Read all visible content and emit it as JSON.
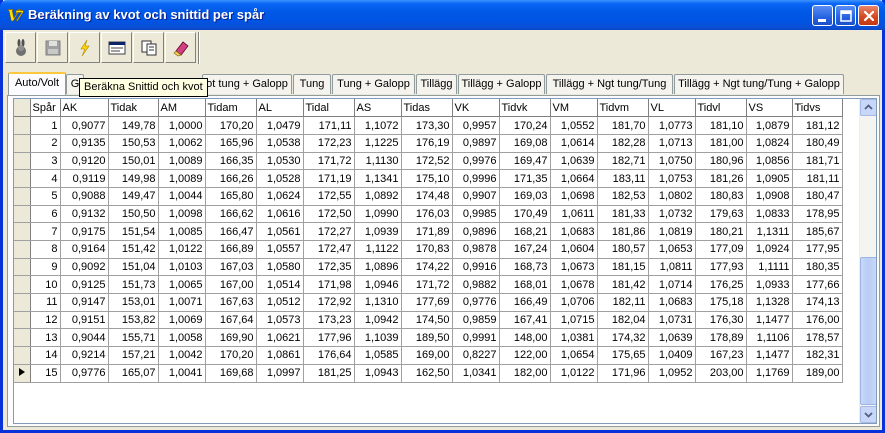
{
  "window": {
    "title": "Beräkning av kvot och snittid per spår",
    "title_color": "#FFFFFF",
    "titlebar_color": "#0054E3"
  },
  "toolbar": {
    "buttons": [
      {
        "name": "rabbit-icon"
      },
      {
        "name": "save-icon"
      },
      {
        "name": "lightning-icon"
      },
      {
        "name": "form-icon"
      },
      {
        "name": "copy-icon"
      },
      {
        "name": "eraser-icon"
      }
    ]
  },
  "tabs": [
    {
      "label": "Auto/Volt",
      "active": true
    },
    {
      "label": "G",
      "active": false
    },
    {
      "label": "ot tung + Galopp",
      "active": false
    },
    {
      "label": "Tung",
      "active": false
    },
    {
      "label": "Tung + Galopp",
      "active": false
    },
    {
      "label": "Tillägg",
      "active": false
    },
    {
      "label": "Tillägg + Galopp",
      "active": false
    },
    {
      "label": "Tillägg + Ngt tung/Tung",
      "active": false
    },
    {
      "label": "Tillägg + Ngt tung/Tung + Galopp",
      "active": false
    }
  ],
  "tooltip": "Beräkna Snittid och kvot",
  "grid": {
    "columns": [
      "Spår",
      "AK",
      "Tidak",
      "AM",
      "Tidam",
      "AL",
      "Tidal",
      "AS",
      "Tidas",
      "VK",
      "Tidvk",
      "VM",
      "Tidvm",
      "VL",
      "Tidvl",
      "VS",
      "Tidvs"
    ],
    "current_row_index": 14,
    "rows": [
      [
        "1",
        "0,9077",
        "149,78",
        "1,0000",
        "170,20",
        "1,0479",
        "171,11",
        "1,1072",
        "173,30",
        "0,9957",
        "170,24",
        "1,0552",
        "181,70",
        "1,0773",
        "181,10",
        "1,0879",
        "181,12"
      ],
      [
        "2",
        "0,9135",
        "150,53",
        "1,0062",
        "165,96",
        "1,0538",
        "172,23",
        "1,1225",
        "176,19",
        "0,9897",
        "169,08",
        "1,0614",
        "182,28",
        "1,0713",
        "181,00",
        "1,0824",
        "180,49"
      ],
      [
        "3",
        "0,9120",
        "150,01",
        "1,0089",
        "166,35",
        "1,0530",
        "171,72",
        "1,1130",
        "172,52",
        "0,9976",
        "169,47",
        "1,0639",
        "182,71",
        "1,0750",
        "180,96",
        "1,0856",
        "181,71"
      ],
      [
        "4",
        "0,9119",
        "149,98",
        "1,0089",
        "166,26",
        "1,0528",
        "171,19",
        "1,1341",
        "175,10",
        "0,9996",
        "171,35",
        "1,0664",
        "183,11",
        "1,0753",
        "181,26",
        "1,0905",
        "181,11"
      ],
      [
        "5",
        "0,9088",
        "149,47",
        "1,0044",
        "165,80",
        "1,0624",
        "172,55",
        "1,0892",
        "174,48",
        "0,9907",
        "169,03",
        "1,0698",
        "182,53",
        "1,0802",
        "180,83",
        "1,0908",
        "180,47"
      ],
      [
        "6",
        "0,9132",
        "150,50",
        "1,0098",
        "166,62",
        "1,0616",
        "172,50",
        "1,0990",
        "176,03",
        "0,9985",
        "170,49",
        "1,0611",
        "181,33",
        "1,0732",
        "179,63",
        "1,0833",
        "178,95"
      ],
      [
        "7",
        "0,9175",
        "151,54",
        "1,0085",
        "166,47",
        "1,0561",
        "172,27",
        "1,0939",
        "171,89",
        "0,9896",
        "168,21",
        "1,0683",
        "181,86",
        "1,0819",
        "180,21",
        "1,1311",
        "185,67"
      ],
      [
        "8",
        "0,9164",
        "151,42",
        "1,0122",
        "166,89",
        "1,0557",
        "172,47",
        "1,1122",
        "170,83",
        "0,9878",
        "167,24",
        "1,0604",
        "180,57",
        "1,0653",
        "177,09",
        "1,0924",
        "177,95"
      ],
      [
        "9",
        "0,9092",
        "151,04",
        "1,0103",
        "167,03",
        "1,0580",
        "172,35",
        "1,0896",
        "174,22",
        "0,9916",
        "168,73",
        "1,0673",
        "181,15",
        "1,0811",
        "177,93",
        "1,1111",
        "180,35"
      ],
      [
        "10",
        "0,9125",
        "151,73",
        "1,0065",
        "167,00",
        "1,0514",
        "171,98",
        "1,0946",
        "171,72",
        "0,9882",
        "168,01",
        "1,0678",
        "181,42",
        "1,0714",
        "176,25",
        "1,0933",
        "177,66"
      ],
      [
        "11",
        "0,9147",
        "153,01",
        "1,0071",
        "167,63",
        "1,0512",
        "172,92",
        "1,1310",
        "177,69",
        "0,9776",
        "166,49",
        "1,0706",
        "182,11",
        "1,0683",
        "175,18",
        "1,1328",
        "174,13"
      ],
      [
        "12",
        "0,9151",
        "153,82",
        "1,0069",
        "167,64",
        "1,0573",
        "173,23",
        "1,0942",
        "174,50",
        "0,9859",
        "167,41",
        "1,0715",
        "182,04",
        "1,0731",
        "176,30",
        "1,1477",
        "176,00"
      ],
      [
        "13",
        "0,9044",
        "155,71",
        "1,0058",
        "169,90",
        "1,0621",
        "177,96",
        "1,1039",
        "189,50",
        "0,9991",
        "148,00",
        "1,0381",
        "174,32",
        "1,0639",
        "178,89",
        "1,1106",
        "178,57"
      ],
      [
        "14",
        "0,9214",
        "157,21",
        "1,0042",
        "170,20",
        "1,0861",
        "176,64",
        "1,0585",
        "169,00",
        "0,8227",
        "122,00",
        "1,0654",
        "175,65",
        "1,0409",
        "167,23",
        "1,1477",
        "182,31"
      ],
      [
        "15",
        "0,9776",
        "165,07",
        "1,0041",
        "169,68",
        "1,0997",
        "181,25",
        "1,0943",
        "162,50",
        "1,0341",
        "182,00",
        "1,0122",
        "171,96",
        "1,0952",
        "203,00",
        "1,1769",
        "189,00"
      ]
    ]
  }
}
